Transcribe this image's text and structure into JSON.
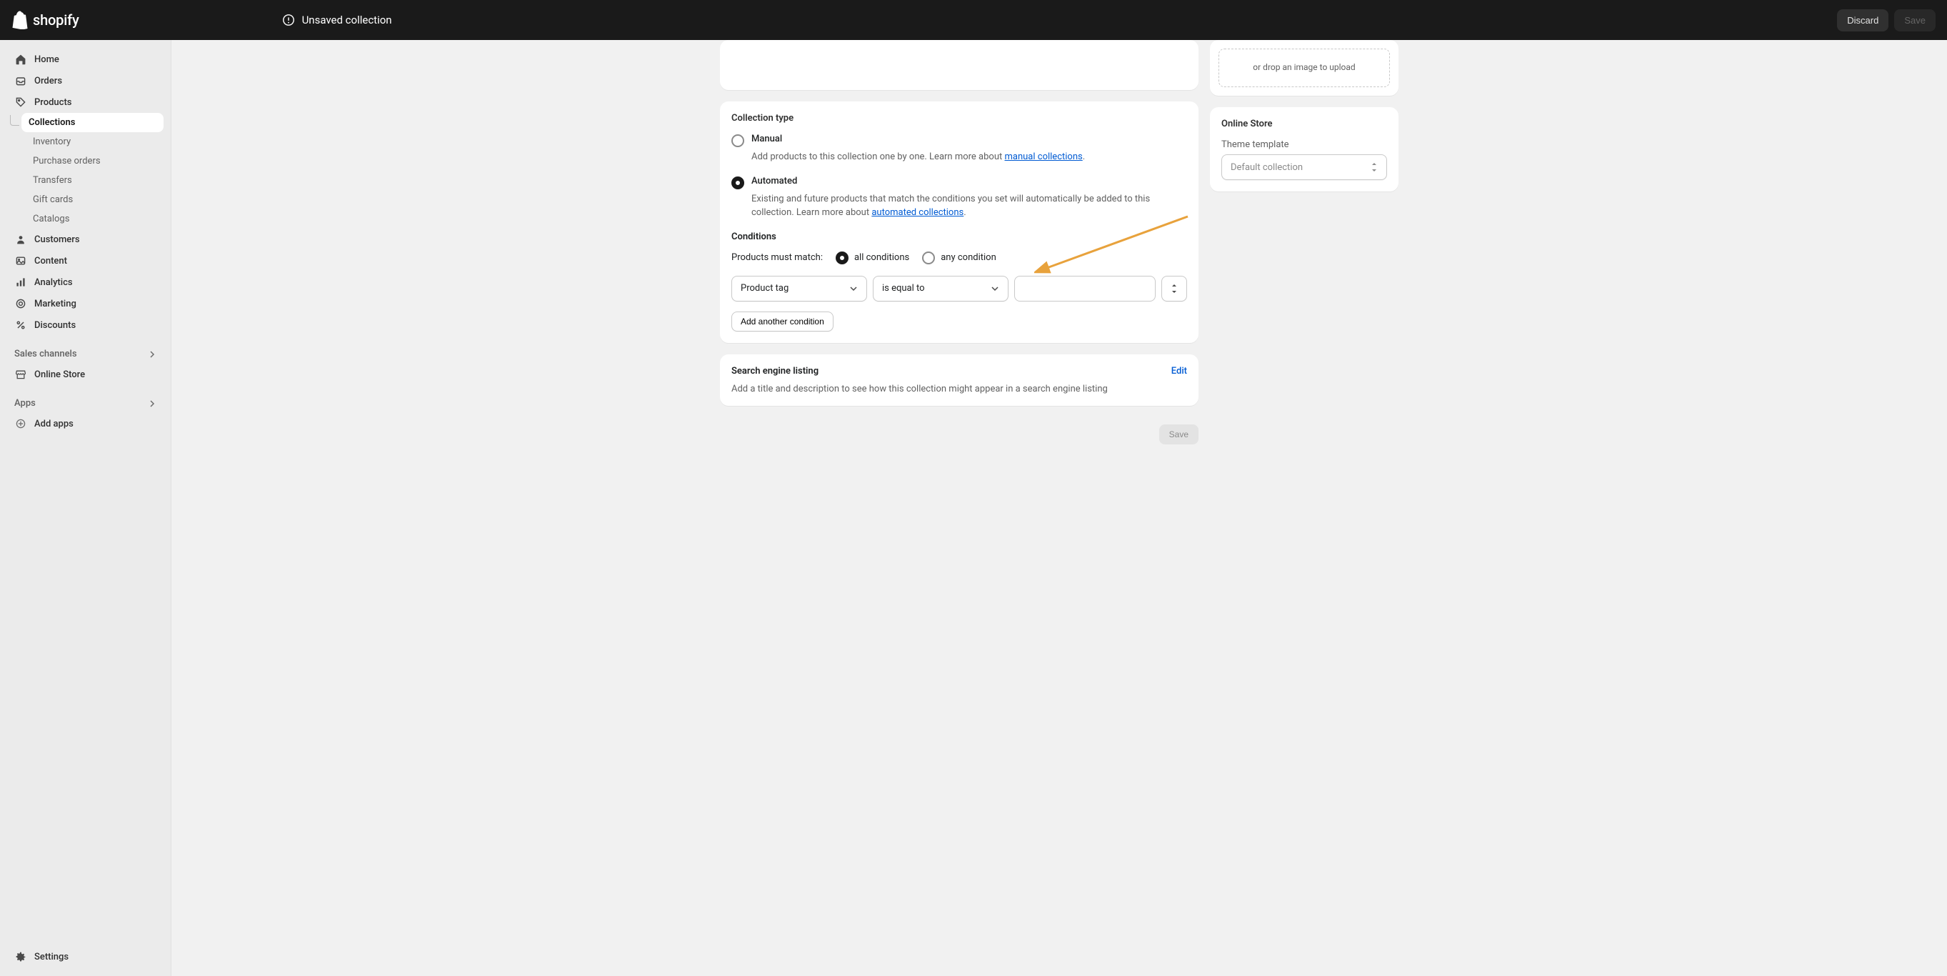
{
  "brand": "shopify",
  "unsaved_banner": "Unsaved collection",
  "topbar": {
    "discard": "Discard",
    "save": "Save"
  },
  "sidebar": {
    "home": "Home",
    "orders": "Orders",
    "products": "Products",
    "collections": "Collections",
    "inventory": "Inventory",
    "purchase_orders": "Purchase orders",
    "transfers": "Transfers",
    "gift_cards": "Gift cards",
    "catalogs": "Catalogs",
    "customers": "Customers",
    "content": "Content",
    "analytics": "Analytics",
    "marketing": "Marketing",
    "discounts": "Discounts",
    "sales_channels_header": "Sales channels",
    "online_store": "Online Store",
    "apps_header": "Apps",
    "add_apps": "Add apps",
    "settings": "Settings"
  },
  "image_card": {
    "drop_hint": "or drop an image to upload"
  },
  "online_store_card": {
    "title": "Online Store",
    "template_label": "Theme template",
    "template_value": "Default collection"
  },
  "collection_type": {
    "title": "Collection type",
    "manual": {
      "label": "Manual",
      "desc_prefix": "Add products to this collection one by one. Learn more about ",
      "link": "manual collections",
      "desc_suffix": "."
    },
    "automated": {
      "label": "Automated",
      "desc_prefix": "Existing and future products that match the conditions you set will automatically be added to this collection. Learn more about ",
      "link": "automated collections",
      "desc_suffix": "."
    }
  },
  "conditions": {
    "title": "Conditions",
    "match_prefix": "Products must match:",
    "all": "all conditions",
    "any": "any condition",
    "field": "Product tag",
    "operator": "is equal to",
    "value": "",
    "add_another": "Add another condition"
  },
  "seo": {
    "title": "Search engine listing",
    "edit": "Edit",
    "desc": "Add a title and description to see how this collection might appear in a search engine listing"
  },
  "bottom_save": "Save"
}
